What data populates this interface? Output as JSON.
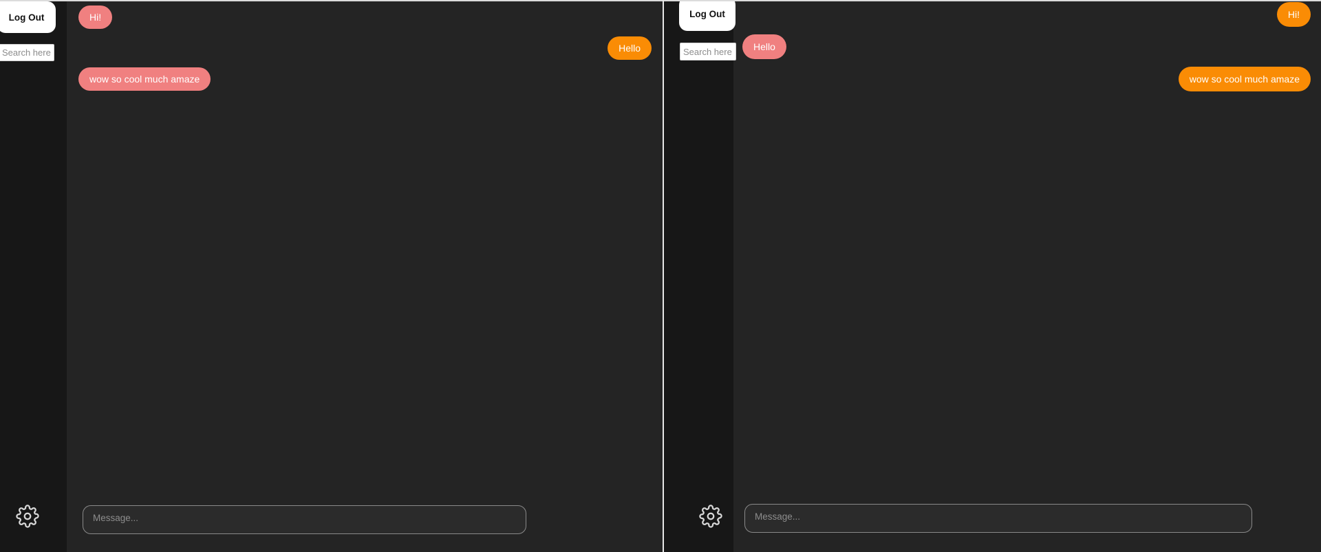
{
  "app": {
    "background_color": "#242424",
    "sidebar_color": "#171717",
    "accent_orange": "#fa8c05",
    "accent_pink": "#f08080"
  },
  "panels": [
    {
      "id": "left-window",
      "sidebar": {
        "logout_label": "Log Out",
        "search_placeholder": "Search here",
        "search_value": "",
        "settings_icon": "gear-icon"
      },
      "chat": {
        "messages": [
          {
            "text": "Hi!",
            "side": "incoming",
            "color": "pink"
          },
          {
            "text": "Hello",
            "side": "outgoing",
            "color": "orange"
          },
          {
            "text": "wow so cool much amaze",
            "side": "incoming",
            "color": "pink"
          }
        ],
        "composer": {
          "placeholder": "Message...",
          "value": ""
        }
      }
    },
    {
      "id": "right-window",
      "sidebar": {
        "logout_label": "Log Out",
        "search_placeholder": "Search here",
        "search_value": "",
        "settings_icon": "gear-icon"
      },
      "chat": {
        "messages": [
          {
            "text": "Hi!",
            "side": "outgoing",
            "color": "orange"
          },
          {
            "text": "Hello",
            "side": "incoming",
            "color": "pink"
          },
          {
            "text": "wow so cool much amaze",
            "side": "outgoing",
            "color": "orange"
          }
        ],
        "composer": {
          "placeholder": "Message...",
          "value": ""
        }
      }
    }
  ]
}
